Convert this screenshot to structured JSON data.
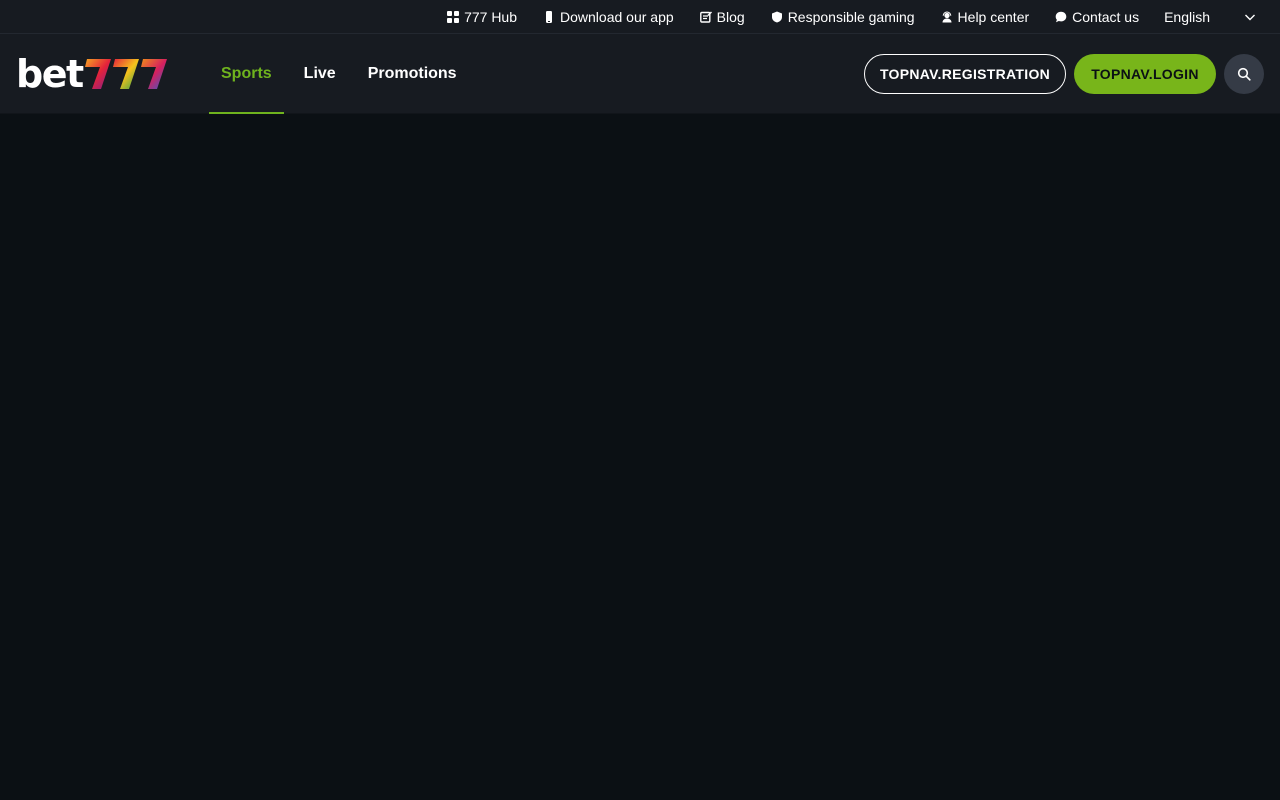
{
  "utility_bar": {
    "items": [
      {
        "label": "777 Hub",
        "icon": "grid-icon"
      },
      {
        "label": "Download our app",
        "icon": "phone-icon"
      },
      {
        "label": "Blog",
        "icon": "blog-icon"
      },
      {
        "label": "Responsible gaming",
        "icon": "shield-icon"
      },
      {
        "label": "Help center",
        "icon": "support-agent-icon"
      },
      {
        "label": "Contact us",
        "icon": "chat-bubble-icon"
      }
    ],
    "language": {
      "selected": "English",
      "icon": "chevron-down-icon"
    }
  },
  "header": {
    "logo": {
      "text": "bet",
      "digits": "777"
    },
    "tabs": [
      {
        "label": "Sports",
        "active": true
      },
      {
        "label": "Live",
        "active": false
      },
      {
        "label": "Promotions",
        "active": false
      }
    ],
    "registration_label": "TOPNAV.REGISTRATION",
    "login_label": "TOPNAV.LOGIN",
    "search_icon": "search-icon"
  },
  "colors": {
    "background": "#0b1014",
    "header": "#171b21",
    "accent": "#78b51a",
    "active_tab": "#6fb31e",
    "search_button": "#353b46"
  }
}
